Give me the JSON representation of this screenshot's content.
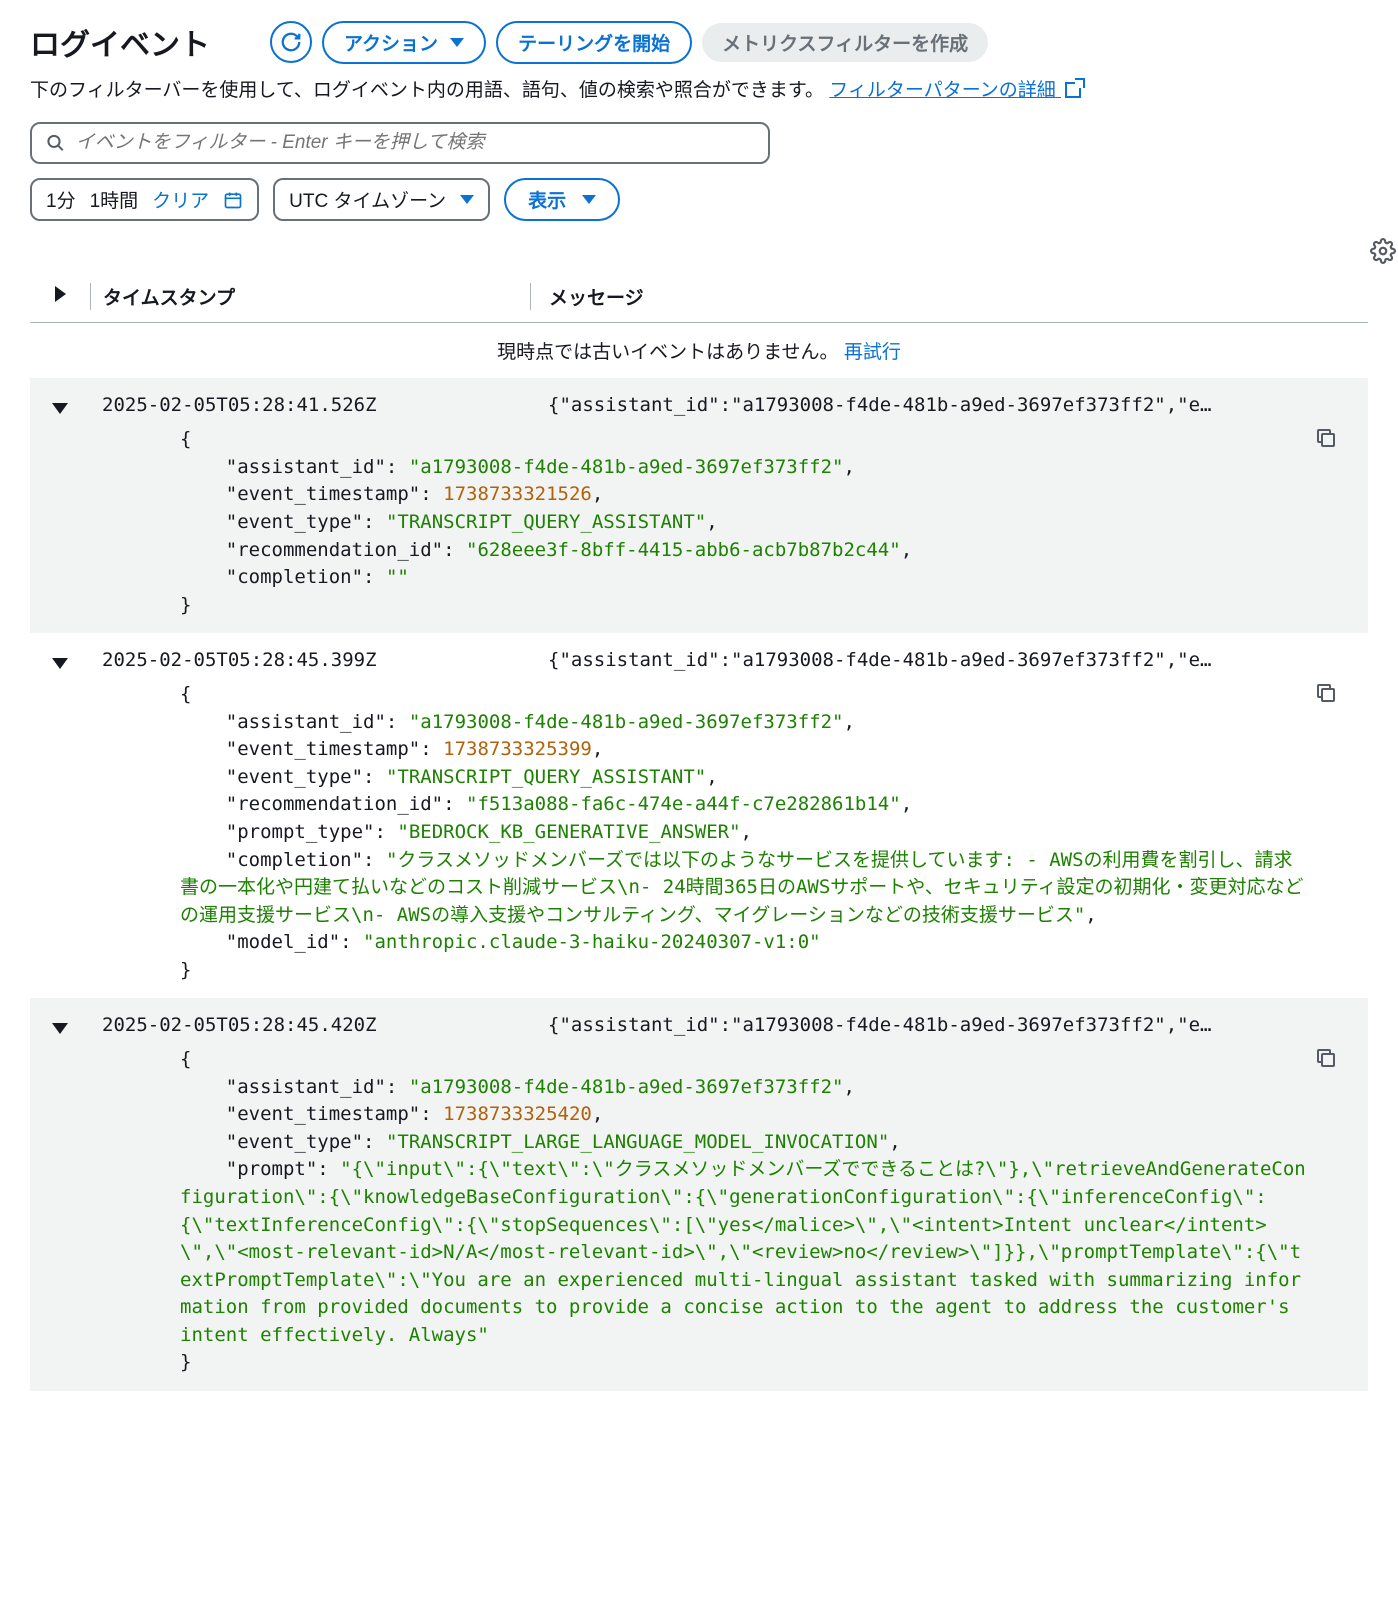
{
  "header": {
    "title": "ログイベント",
    "actions_label": "アクション",
    "start_tailing_label": "テーリングを開始",
    "create_metrics_filter_label": "メトリクスフィルターを作成"
  },
  "subtitle": {
    "text": "下のフィルターバーを使用して、ログイベント内の用語、語句、値の検索や照合ができます。",
    "link_text": "フィルターパターンの詳細"
  },
  "search": {
    "placeholder": "イベントをフィルター - Enter キーを押して検索"
  },
  "time_controls": {
    "one_minute": "1分",
    "one_hour": "1時間",
    "clear": "クリア",
    "timezone_label": "UTC タイムゾーン",
    "display_label": "表示"
  },
  "table_headers": {
    "timestamp": "タイムスタンプ",
    "message": "メッセージ"
  },
  "no_older": {
    "text": "現時点では古いイベントはありません。",
    "retry": "再試行"
  },
  "events": [
    {
      "timestamp": "2025-02-05T05:28:41.526Z",
      "summary": "{\"assistant_id\":\"a1793008-f4de-481b-a9ed-3697ef373ff2\",\"e…",
      "details": {
        "assistant_id": "a1793008-f4de-481b-a9ed-3697ef373ff2",
        "event_timestamp": 1738733321526,
        "event_type": "TRANSCRIPT_QUERY_ASSISTANT",
        "recommendation_id": "628eee3f-8bff-4415-abb6-acb7b87b2c44",
        "completion": ""
      }
    },
    {
      "timestamp": "2025-02-05T05:28:45.399Z",
      "summary": "{\"assistant_id\":\"a1793008-f4de-481b-a9ed-3697ef373ff2\",\"e…",
      "details": {
        "assistant_id": "a1793008-f4de-481b-a9ed-3697ef373ff2",
        "event_timestamp": 1738733325399,
        "event_type": "TRANSCRIPT_QUERY_ASSISTANT",
        "recommendation_id": "f513a088-fa6c-474e-a44f-c7e282861b14",
        "prompt_type": "BEDROCK_KB_GENERATIVE_ANSWER",
        "completion": "クラスメソッドメンバーズでは以下のようなサービスを提供しています: - AWSの利用費を割引し、請求書の一本化や円建て払いなどのコスト削減サービス\\n- 24時間365日のAWSサポートや、セキュリティ設定の初期化・変更対応などの運用支援サービス\\n- AWSの導入支援やコンサルティング、マイグレーションなどの技術支援サービス",
        "model_id": "anthropic.claude-3-haiku-20240307-v1:0"
      }
    },
    {
      "timestamp": "2025-02-05T05:28:45.420Z",
      "summary": "{\"assistant_id\":\"a1793008-f4de-481b-a9ed-3697ef373ff2\",\"e…",
      "details": {
        "assistant_id": "a1793008-f4de-481b-a9ed-3697ef373ff2",
        "event_timestamp": 1738733325420,
        "event_type": "TRANSCRIPT_LARGE_LANGUAGE_MODEL_INVOCATION",
        "prompt": "{\\\"input\\\":{\\\"text\\\":\\\"クラスメソッドメンバーズでできることは?\\\"},\\\"retrieveAndGenerateConfiguration\\\":{\\\"knowledgeBaseConfiguration\\\":{\\\"generationConfiguration\\\":{\\\"inferenceConfig\\\":{\\\"textInferenceConfig\\\":{\\\"stopSequences\\\":[\\\"yes</malice>\\\",\\\"<intent>Intent unclear</intent>\\\",\\\"<most-relevant-id>N/A</most-relevant-id>\\\",\\\"<review>no</review>\\\"]}},\\\"promptTemplate\\\":{\\\"textPromptTemplate\\\":\\\"You are an experienced multi-lingual assistant tasked with summarizing information from provided documents to provide a concise action to the agent to address the customer's intent effectively. Always"
      }
    }
  ]
}
